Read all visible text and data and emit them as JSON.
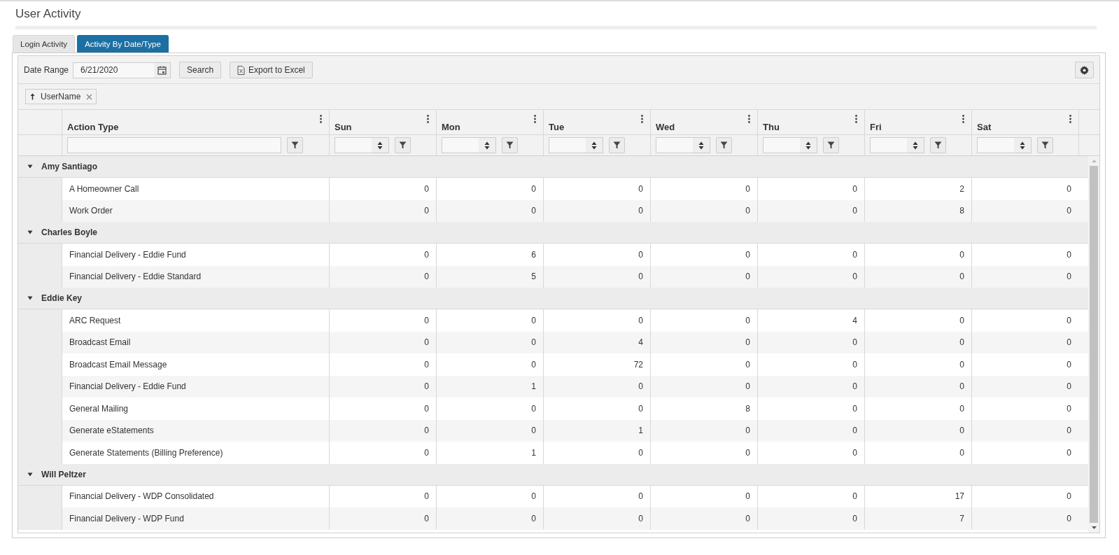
{
  "page_title": "User Activity",
  "tabs": [
    {
      "label": "Login Activity",
      "selected": false
    },
    {
      "label": "Activity By Date/Type",
      "selected": true
    }
  ],
  "toolbar": {
    "date_label": "Date Range",
    "date_value": "6/21/2020",
    "search_button": "Search",
    "export_button": "Export to Excel"
  },
  "group_chip": {
    "label": "UserName"
  },
  "columns": [
    {
      "label": "Action Type",
      "kind": "text"
    },
    {
      "label": "Sun",
      "kind": "number"
    },
    {
      "label": "Mon",
      "kind": "number"
    },
    {
      "label": "Tue",
      "kind": "number"
    },
    {
      "label": "Wed",
      "kind": "number"
    },
    {
      "label": "Thu",
      "kind": "number"
    },
    {
      "label": "Fri",
      "kind": "number"
    },
    {
      "label": "Sat",
      "kind": "number"
    }
  ],
  "groups": [
    {
      "name": "Amy Santiago",
      "expanded": true,
      "rows": [
        {
          "action": "A Homeowner Call",
          "values": [
            "0",
            "0",
            "0",
            "0",
            "0",
            "2",
            "0"
          ]
        },
        {
          "action": "Work Order",
          "values": [
            "0",
            "0",
            "0",
            "0",
            "0",
            "8",
            "0"
          ]
        }
      ]
    },
    {
      "name": "Charles Boyle",
      "expanded": true,
      "rows": [
        {
          "action": "Financial Delivery - Eddie Fund",
          "values": [
            "0",
            "6",
            "0",
            "0",
            "0",
            "0",
            "0"
          ]
        },
        {
          "action": "Financial Delivery - Eddie Standard",
          "values": [
            "0",
            "5",
            "0",
            "0",
            "0",
            "0",
            "0"
          ]
        }
      ]
    },
    {
      "name": "Eddie Key",
      "expanded": true,
      "rows": [
        {
          "action": "ARC Request",
          "values": [
            "0",
            "0",
            "0",
            "0",
            "4",
            "0",
            "0"
          ]
        },
        {
          "action": "Broadcast Email",
          "values": [
            "0",
            "0",
            "4",
            "0",
            "0",
            "0",
            "0"
          ]
        },
        {
          "action": "Broadcast Email Message",
          "values": [
            "0",
            "0",
            "72",
            "0",
            "0",
            "0",
            "0"
          ]
        },
        {
          "action": "Financial Delivery - Eddie Fund",
          "values": [
            "0",
            "1",
            "0",
            "0",
            "0",
            "0",
            "0"
          ]
        },
        {
          "action": "General Mailing",
          "values": [
            "0",
            "0",
            "0",
            "8",
            "0",
            "0",
            "0"
          ]
        },
        {
          "action": "Generate eStatements",
          "values": [
            "0",
            "0",
            "1",
            "0",
            "0",
            "0",
            "0"
          ]
        },
        {
          "action": "Generate Statements (Billing Preference)",
          "values": [
            "0",
            "1",
            "0",
            "0",
            "0",
            "0",
            "0"
          ]
        }
      ]
    },
    {
      "name": "Will Peltzer",
      "expanded": true,
      "rows": [
        {
          "action": "Financial Delivery - WDP Consolidated",
          "values": [
            "0",
            "0",
            "0",
            "0",
            "0",
            "17",
            "0"
          ]
        },
        {
          "action": "Financial Delivery - WDP Fund",
          "values": [
            "0",
            "0",
            "0",
            "0",
            "0",
            "7",
            "0"
          ]
        }
      ]
    }
  ]
}
